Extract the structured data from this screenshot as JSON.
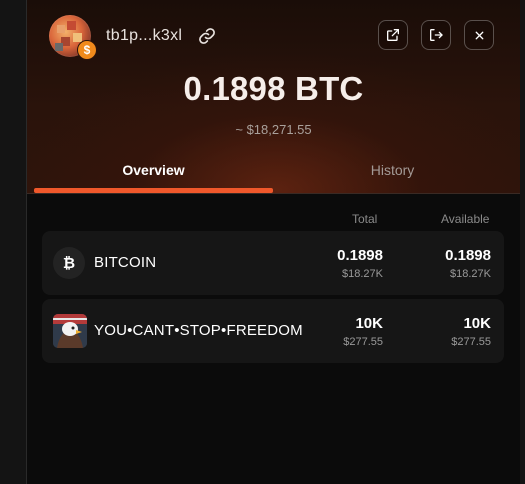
{
  "header": {
    "address": "tb1p...k3xl",
    "badge_symbol": "$",
    "icons": [
      "link-icon",
      "external-link-icon",
      "logout-icon",
      "close-icon"
    ]
  },
  "balance": {
    "amount": "0.1898 BTC",
    "fiat": "~ $18,271.55"
  },
  "tabs": [
    {
      "label": "Overview",
      "active": true
    },
    {
      "label": "History",
      "active": false
    }
  ],
  "columns": {
    "total": "Total",
    "available": "Available"
  },
  "tokens": [
    {
      "icon": "₿",
      "name": "BITCOIN",
      "total": "0.1898",
      "total_fiat": "$18.27K",
      "available": "0.1898",
      "available_fiat": "$18.27K"
    },
    {
      "icon": "eagle-token-icon",
      "name": "YOU•CANT•STOP•FREEDOM",
      "total": "10K",
      "total_fiat": "$277.55",
      "available": "10K",
      "available_fiat": "$277.55"
    }
  ],
  "colors": {
    "accent": "#f0582b",
    "row_bg": "#161616",
    "background": "#0b0b0b"
  }
}
